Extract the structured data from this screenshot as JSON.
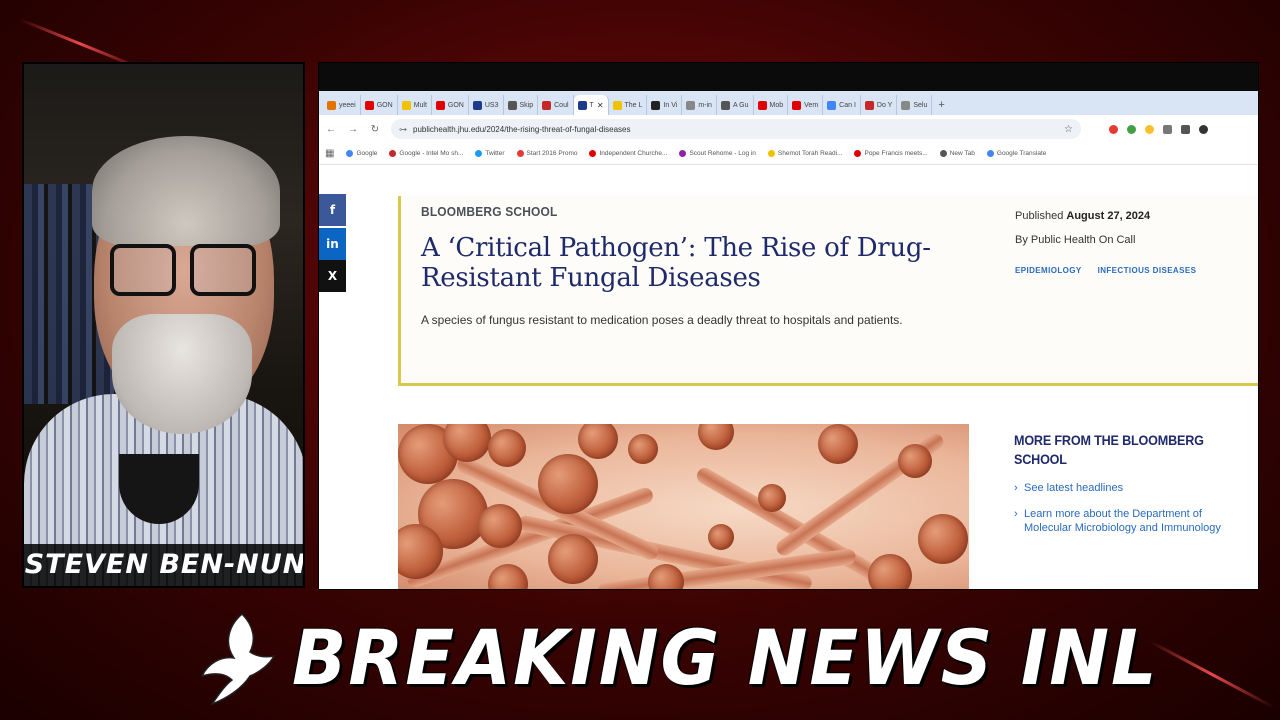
{
  "presenter": {
    "name": "STEVEN BEN-NUN"
  },
  "banner": {
    "title": "BREAKING NEWS INL"
  },
  "browser": {
    "tabs": [
      {
        "label": "yeeei",
        "color": "#e37400"
      },
      {
        "label": "GON",
        "color": "#e00000"
      },
      {
        "label": "Mult",
        "color": "#f2c200"
      },
      {
        "label": "GON",
        "color": "#e00000"
      },
      {
        "label": "US3",
        "color": "#1f3a8a"
      },
      {
        "label": "Skip",
        "color": "#555555"
      },
      {
        "label": "Coul",
        "color": "#c62828"
      },
      {
        "label": "T",
        "color": "#1f3a8a",
        "active": true
      },
      {
        "label": "The L",
        "color": "#f2c200"
      },
      {
        "label": "In Vi",
        "color": "#222222"
      },
      {
        "label": "m-in",
        "color": "#888888"
      },
      {
        "label": "A Gu",
        "color": "#555555"
      },
      {
        "label": "Mob",
        "color": "#e00000"
      },
      {
        "label": "Vem",
        "color": "#e00000"
      },
      {
        "label": "Can I",
        "color": "#4285f4"
      },
      {
        "label": "Do Y",
        "color": "#c62828"
      },
      {
        "label": "Selu",
        "color": "#888888"
      }
    ],
    "url": "publichealth.jhu.edu/2024/the-rising-threat-of-fungal-diseases",
    "bookmarks": [
      {
        "label": "Google",
        "color": "#4285f4"
      },
      {
        "label": "Google - Intel Mo sh...",
        "color": "#c62828"
      },
      {
        "label": "Twitter",
        "color": "#1d9bf0"
      },
      {
        "label": "Start 2016 Promo",
        "color": "#e53935"
      },
      {
        "label": "Independent Churche...",
        "color": "#e00000"
      },
      {
        "label": "Scout Rehome - Log in",
        "color": "#8e24aa"
      },
      {
        "label": "Shemot Torah Readi...",
        "color": "#f2c200"
      },
      {
        "label": "Pope Francis meets...",
        "color": "#e00000"
      },
      {
        "label": "New Tab",
        "color": "#555555"
      },
      {
        "label": "Google Translate",
        "color": "#4285f4"
      }
    ]
  },
  "article": {
    "eyebrow": "BLOOMBERG SCHOOL",
    "headline": "A ‘Critical Pathogen’: The Rise of Drug-Resistant Fungal Diseases",
    "dek": "A species of fungus resistant to medication poses a deadly threat to hospitals and patients.",
    "published_label": "Published",
    "published_date": "August 27, 2024",
    "byline": "By Public Health On Call",
    "tags": [
      "EPIDEMIOLOGY",
      "INFECTIOUS DISEASES"
    ]
  },
  "sidebar": {
    "heading": "MORE FROM THE BLOOMBERG SCHOOL",
    "links": [
      "See latest headlines",
      "Learn more about the Department of Molecular Microbiology and Immunology"
    ]
  },
  "share": [
    {
      "icon": "f",
      "color": "#3b5998"
    },
    {
      "icon": "in",
      "color": "#0a66c2"
    },
    {
      "icon": "X",
      "color": "#111111"
    }
  ]
}
